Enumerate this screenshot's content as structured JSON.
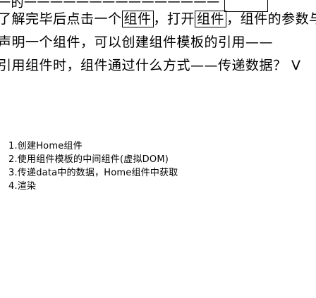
{
  "partial_top_line": "一的一一一一一一一一一一一一一一一",
  "paragraph_lines": [
    "了解完毕后点击一个组件，打开组件，组件的参数与一",
    "声明一个组件，可以创建组件模板的引用——",
    "引用组件时，组件通过什么方式——传递数据？ V"
  ],
  "boxed_words": [
    "组件",
    "模板",
    "组件",
    "参数"
  ],
  "steps": [
    "1.创建Home组件",
    "2.使用组件模板的中间组件(虚拟DOM)",
    "3.传递data中的数据，Home组件中获取",
    "4.渲染"
  ]
}
